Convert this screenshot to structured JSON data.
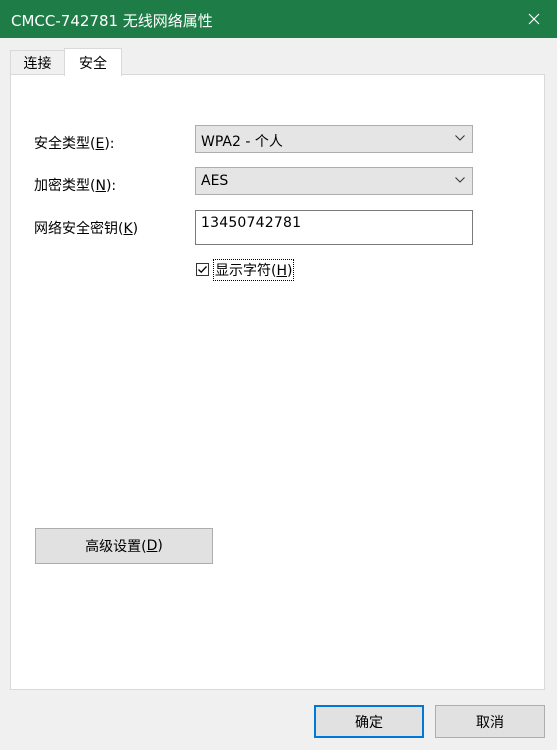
{
  "window": {
    "title": "CMCC-742781 无线网络属性",
    "close_icon": "close-icon"
  },
  "tabs": [
    {
      "label": "连接",
      "active": false
    },
    {
      "label": "安全",
      "active": true
    }
  ],
  "security": {
    "security_type": {
      "label_prefix": "安全类型(",
      "accel": "E",
      "label_suffix": "):",
      "value": "WPA2 - 个人"
    },
    "encryption_type": {
      "label_prefix": "加密类型(",
      "accel": "N",
      "label_suffix": "):",
      "value": "AES"
    },
    "network_key": {
      "label_prefix": "网络安全密钥(",
      "accel": "K",
      "label_suffix": ")",
      "value": "13450742781"
    },
    "show_chars": {
      "label_prefix": "显示字符(",
      "accel": "H",
      "label_suffix": ")",
      "checked": true
    },
    "advanced_button": {
      "label_prefix": "高级设置(",
      "accel": "D",
      "label_suffix": ")"
    }
  },
  "footer": {
    "ok_label": "确定",
    "cancel_label": "取消"
  },
  "colors": {
    "titlebar": "#1e7c47",
    "focus_border": "#0078d7"
  }
}
